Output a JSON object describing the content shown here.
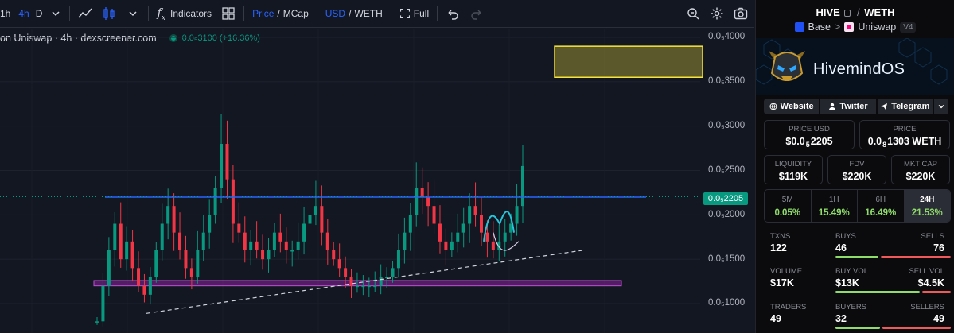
{
  "toolbar": {
    "timeframes": [
      "1h",
      "4h",
      "D"
    ],
    "indicators_label": "Indicators",
    "price_label": "Price",
    "slash": "/",
    "mcap_label": "MCap",
    "usd_label": "USD",
    "weth_label": "WETH",
    "full_label": "Full",
    "colors": {
      "active": "#2962ff",
      "text": "#d1d4dc"
    }
  },
  "legend": {
    "source": "on Uniswap · 4h · dexscreener.com",
    "price_change": "0.0₅3100 (+16.36%)"
  },
  "chart_data": {
    "type": "candlestick",
    "xlabel": "",
    "ylabel": "",
    "yticks": [
      "0.0₅4000",
      "0.0₅3500",
      "0.0₅3000",
      "0.0₅2500",
      "0.0₅2000",
      "0.0₅1500",
      "0.0₅1000"
    ],
    "ytick_values": [
      4e-06,
      3.5e-06,
      3e-06,
      2.5e-06,
      2e-06,
      1.5e-06,
      1e-06
    ],
    "ylim": [
      8e-07,
      4.15e-06
    ],
    "current_price_label": "0.0₅2205",
    "current_price": 2.205e-06,
    "closes": [
      8e-07,
      1.2e-06,
      1.6e-06,
      1.9e-06,
      1.5e-06,
      1.7e-06,
      1.4e-06,
      1.2e-06,
      1.1e-06,
      1.3e-06,
      1.6e-06,
      1.9e-06,
      2.1e-06,
      1.8e-06,
      1.6e-06,
      1.4e-06,
      1.3e-06,
      1.6e-06,
      1.8e-06,
      2e-06,
      2.3e-06,
      2.8e-06,
      2.4e-06,
      1.9e-06,
      1.8e-06,
      1.6e-06,
      1.7e-06,
      1.6e-06,
      1.5e-06,
      1.6e-06,
      1.8e-06,
      1.7e-06,
      1.6e-06,
      1.6e-06,
      1.7e-06,
      1.9e-06,
      2e-06,
      2.1e-06,
      1.8e-06,
      1.6e-06,
      1.5e-06,
      1.4e-06,
      1.3e-06,
      1.2e-06,
      1.2e-06,
      1.2e-06,
      1.2e-06,
      1.2e-06,
      1.3e-06,
      1.3e-06,
      1.4e-06,
      1.6e-06,
      1.8e-06,
      2e-06,
      2.3e-06,
      2.2e-06,
      2.1e-06,
      1.9e-06,
      1.7e-06,
      1.6e-06,
      1.7e-06,
      1.8e-06,
      1.9e-06,
      2.1e-06,
      2e-06,
      1.8e-06,
      1.7e-06,
      1.6e-06,
      1.7e-06,
      1.8e-06,
      1.9e-06,
      2.1e-06,
      2.55e-06
    ],
    "annotations": {
      "horizontal_line_price": 2.2e-06,
      "yellow_zone": [
        3.55e-06,
        3.9e-06
      ],
      "purple_zone": [
        1.2e-06,
        1.26e-06
      ],
      "trendline": [
        [
          8.9e-07
        ],
        [
          1.6e-06
        ]
      ]
    },
    "colors": {
      "up": "#089981",
      "down": "#f23645",
      "hline": "#2962ff",
      "zone_yellow": "#f6e33d",
      "zone_purple": "#9c27b0",
      "cyan": "#26c6da"
    }
  },
  "pair": {
    "base": "HIVE",
    "quote": "WETH",
    "separator": "/",
    "chain": "Base",
    "dex": "Uniswap",
    "version": "V4",
    "chevron": ">"
  },
  "banner": {
    "title": "HivemindOS"
  },
  "links": {
    "website": "Website",
    "twitter": "Twitter",
    "telegram": "Telegram"
  },
  "stats": {
    "price_usd_label": "PRICE USD",
    "price_usd_prefix": "$0.0",
    "price_usd_sub": "5",
    "price_usd_suffix": "2205",
    "price_label": "PRICE",
    "price_prefix": "0.0",
    "price_sub": "8",
    "price_suffix": "1303 WETH",
    "liquidity_label": "LIQUIDITY",
    "liquidity": "$119K",
    "fdv_label": "FDV",
    "fdv": "$220K",
    "mktcap_label": "MKT CAP",
    "mktcap": "$220K"
  },
  "periods": [
    {
      "name": "5M",
      "value": "0.05%"
    },
    {
      "name": "1H",
      "value": "15.49%"
    },
    {
      "name": "6H",
      "value": "16.49%"
    },
    {
      "name": "24H",
      "value": "21.53%"
    }
  ],
  "txns": {
    "txns_label": "TXNS",
    "txns": "122",
    "buys_label": "BUYS",
    "buys": "46",
    "sells_label": "SELLS",
    "sells": "76",
    "volume_label": "VOLUME",
    "volume": "$17K",
    "buy_vol_label": "BUY VOL",
    "buy_vol": "$13K",
    "sell_vol_label": "SELL VOL",
    "sell_vol": "$4.5K",
    "traders_label": "TRADERS",
    "traders": "49",
    "buyers_label": "BUYERS",
    "buyers": "32",
    "sellers_label": "SELLERS",
    "sellers": "49",
    "buys_fraction": 0.377,
    "buy_vol_fraction": 0.743,
    "buyers_fraction": 0.395
  }
}
